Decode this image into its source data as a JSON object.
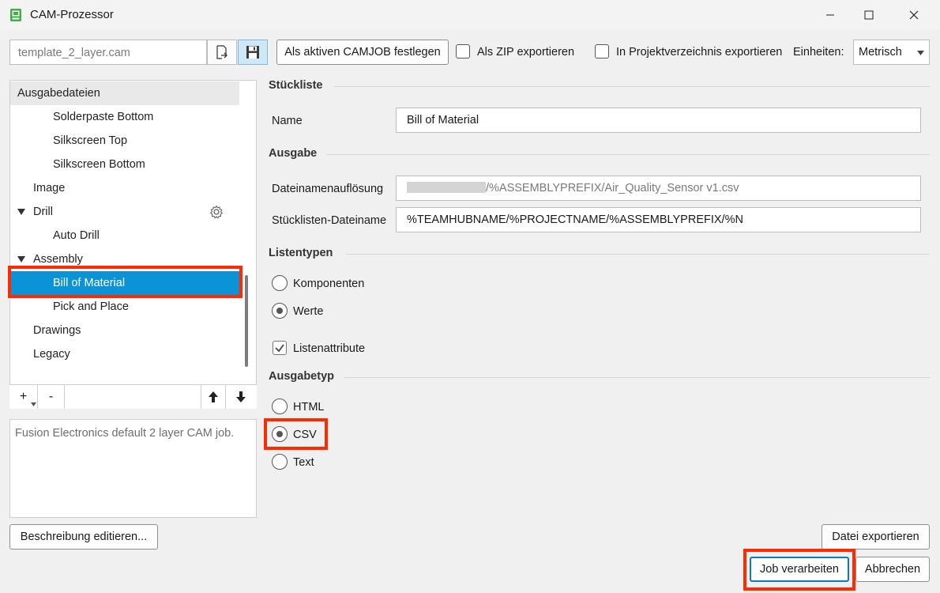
{
  "window": {
    "title": "CAM-Prozessor",
    "icons": [
      "cam-processor-app-icon",
      "minimize-icon",
      "maximize-icon",
      "close-icon"
    ]
  },
  "toolbar": {
    "template_input_value": "template_2_layer.cam",
    "open_file_icon": "open-file-icon",
    "save_icon": "save-icon",
    "set_active_button": "Als aktiven CAMJOB festlegen",
    "zip_export_label": "Als ZIP exportieren",
    "zip_export_checked": false,
    "project_export_label": "In Projektverzeichnis exportieren",
    "project_export_checked": false,
    "units_label": "Einheiten:",
    "units_value": "Metrisch"
  },
  "tree": {
    "header": "Ausgabedateien",
    "items": [
      {
        "label": "Solderpaste Bottom"
      },
      {
        "label": "Silkscreen Top"
      },
      {
        "label": "Silkscreen Bottom"
      },
      {
        "label": "Image"
      },
      {
        "label": "Drill"
      },
      {
        "label": "Auto Drill"
      },
      {
        "label": "Assembly"
      },
      {
        "label": "Bill of Material"
      },
      {
        "label": "Pick and Place"
      },
      {
        "label": "Drawings"
      },
      {
        "label": "Legacy"
      }
    ],
    "selected": "Bill of Material",
    "footer": {
      "add": "+",
      "remove": "-"
    }
  },
  "description": "Fusion Electronics default 2 layer CAM job.",
  "edit_description_button": "Beschreibung editieren...",
  "bom": {
    "section_title": "Stückliste",
    "name_label": "Name",
    "name_value": "Bill of Material",
    "output_section": "Ausgabe",
    "filename_resolution_label": "Dateinamenauflösung",
    "filename_resolution_value": "/%ASSEMBLYPREFIX/Air_Quality_Sensor v1.csv",
    "bom_filename_label": "Stücklisten-Dateiname",
    "bom_filename_value": "%TEAMHUBNAME/%PROJECTNAME/%ASSEMBLYPREFIX/%N",
    "list_types_section": "Listentypen",
    "list_type_options": [
      "Komponenten",
      "Werte"
    ],
    "list_type_selected": "Werte",
    "list_attributes_label": "Listenattribute",
    "list_attributes_checked": true,
    "output_type_section": "Ausgabetyp",
    "output_type_options": [
      "HTML",
      "CSV",
      "Text"
    ],
    "output_type_selected": "CSV"
  },
  "footer_buttons": {
    "export_file": "Datei exportieren",
    "process_job": "Job verarbeiten",
    "cancel": "Abbrechen"
  },
  "colors": {
    "selection": "#0b93d8",
    "highlight": "#ff2a00"
  }
}
